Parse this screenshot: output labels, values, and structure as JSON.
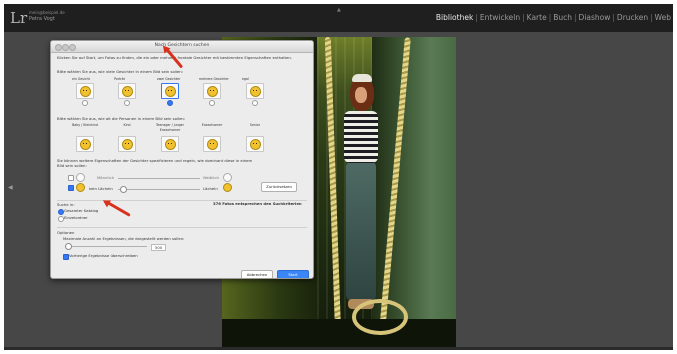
{
  "topbar": {
    "logo": "Lr",
    "user_email": "mein@beispiel.de",
    "user_name": "Petra Vogt",
    "modules": [
      {
        "label": "Bibliothek",
        "active": true
      },
      {
        "label": "Entwickeln",
        "active": false
      },
      {
        "label": "Karte",
        "active": false
      },
      {
        "label": "Buch",
        "active": false
      },
      {
        "label": "Diashow",
        "active": false
      },
      {
        "label": "Drucken",
        "active": false
      },
      {
        "label": "Web",
        "active": false
      }
    ],
    "separator": "|"
  },
  "dialog": {
    "title": "Nach Gesichtern suchen",
    "intro": "Klicken Sie auf Start, um Fotos zu finden, die ein oder mehrere frontale Gesichter mit bestimmten Eigenschaften enthalten.",
    "count_prompt": "Bitte wählen Sie aus, wie viele Gesichter in einem Bild sein sollen:",
    "count_options": [
      {
        "label": "ein Gesicht",
        "selected": false
      },
      {
        "label": "Porträt",
        "selected": false
      },
      {
        "label": "zwei Gesichter",
        "selected": true
      },
      {
        "label": "mehrere Gesichter",
        "selected": false
      },
      {
        "label": "egal",
        "selected": false
      }
    ],
    "age_prompt": "Bitte wählen Sie aus, wie alt die Personen in einem Bild sein sollen:",
    "age_options": [
      {
        "label": "Baby / Kleinkind"
      },
      {
        "label": "Kind"
      },
      {
        "label": "Teenager / junger Erwachsener"
      },
      {
        "label": "Erwachsener"
      },
      {
        "label": "Senior"
      }
    ],
    "props_prompt": "Sie können weitere Eigenschaften der Gesichter spezifizieren und regeln, wie dominant diese in einem Bild sein sollen:",
    "gender_slider": {
      "left": "Männlich",
      "right": "Weiblich",
      "checked": false
    },
    "smile_slider": {
      "left": "kein Lächeln",
      "right": "Lächeln",
      "checked": true
    },
    "reset_button": "Zurücksetzen",
    "search_in_label": "Suche in:",
    "search_options": [
      {
        "label": "Gesamter Katalog",
        "selected": true
      },
      {
        "label": "Einzelordner",
        "selected": false
      }
    ],
    "result_text": "376 Fotos entsprechen den Suchkriterien",
    "options_label": "Optionen",
    "max_results_label": "Maximale Anzahl an Ergebnissen, die dargestellt werden sollen:",
    "max_results_value": "500",
    "overwrite_label": "Vorherige Ergebnisse überschreiben",
    "overwrite_checked": true,
    "cancel_button": "Abbrechen",
    "start_button": "Start"
  },
  "colors": {
    "accent": "#3478f6",
    "annotation_arrow": "#d8321f",
    "face_icon": "#f2c12e",
    "active_module": "#e8e8e8"
  }
}
